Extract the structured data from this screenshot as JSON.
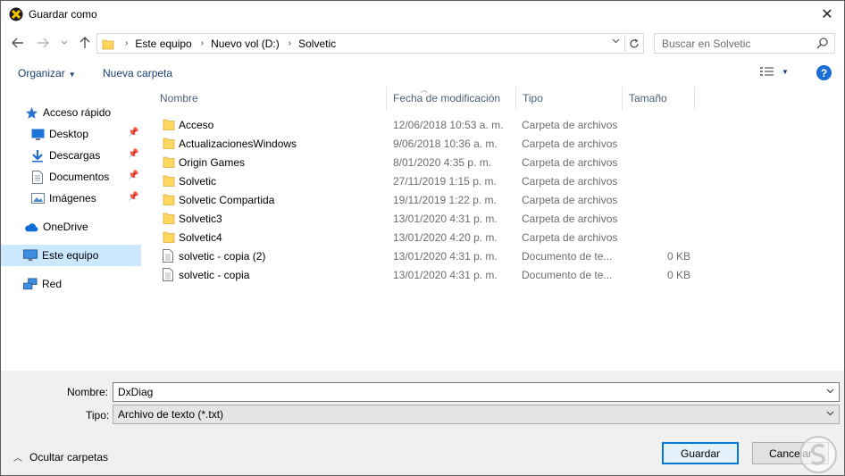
{
  "window": {
    "title": "Guardar como",
    "close_glyph": "✕"
  },
  "address": {
    "crumbs": [
      "Este equipo",
      "Nuevo vol (D:)",
      "Solvetic"
    ],
    "search_placeholder": "Buscar en Solvetic"
  },
  "toolbar": {
    "organize": "Organizar",
    "new_folder": "Nueva carpeta"
  },
  "navpane": {
    "items": [
      {
        "label": "Acceso rápido",
        "icon": "star-icon",
        "pinned": false
      },
      {
        "label": "Desktop",
        "icon": "desktop-folder-icon",
        "pinned": true
      },
      {
        "label": "Descargas",
        "icon": "download-icon",
        "pinned": true
      },
      {
        "label": "Documentos",
        "icon": "document-icon",
        "pinned": true
      },
      {
        "label": "Imágenes",
        "icon": "pictures-icon",
        "pinned": true
      },
      {
        "label": "OneDrive",
        "icon": "cloud-icon",
        "pinned": false
      },
      {
        "label": "Este equipo",
        "icon": "computer-icon",
        "pinned": false,
        "selected": true
      },
      {
        "label": "Red",
        "icon": "network-icon",
        "pinned": false
      }
    ]
  },
  "columns": {
    "name": "Nombre",
    "modified": "Fecha de modificación",
    "type": "Tipo",
    "size": "Tamaño"
  },
  "files": [
    {
      "name": "Acceso",
      "modified": "12/06/2018 10:53 a. m.",
      "type": "Carpeta de archivos",
      "size": "",
      "kind": "folder"
    },
    {
      "name": "ActualizacionesWindows",
      "modified": "9/06/2018 10:36 a. m.",
      "type": "Carpeta de archivos",
      "size": "",
      "kind": "folder"
    },
    {
      "name": "Origin Games",
      "modified": "8/01/2020 4:35 p. m.",
      "type": "Carpeta de archivos",
      "size": "",
      "kind": "folder"
    },
    {
      "name": "Solvetic",
      "modified": "27/11/2019 1:15 p. m.",
      "type": "Carpeta de archivos",
      "size": "",
      "kind": "folder"
    },
    {
      "name": "Solvetic Compartida",
      "modified": "19/11/2019 1:22 p. m.",
      "type": "Carpeta de archivos",
      "size": "",
      "kind": "folder"
    },
    {
      "name": "Solvetic3",
      "modified": "13/01/2020 4:31 p. m.",
      "type": "Carpeta de archivos",
      "size": "",
      "kind": "folder"
    },
    {
      "name": "Solvetic4",
      "modified": "13/01/2020 4:20 p. m.",
      "type": "Carpeta de archivos",
      "size": "",
      "kind": "folder"
    },
    {
      "name": "solvetic - copia (2)",
      "modified": "13/01/2020 4:31 p. m.",
      "type": "Documento de te...",
      "size": "0 KB",
      "kind": "file"
    },
    {
      "name": "solvetic - copia",
      "modified": "13/01/2020 4:31 p. m.",
      "type": "Documento de te...",
      "size": "0 KB",
      "kind": "file"
    }
  ],
  "form": {
    "name_label": "Nombre:",
    "name_value": "DxDiag",
    "type_label": "Tipo:",
    "type_value": "Archivo de texto (*.txt)",
    "hide_folders": "Ocultar carpetas",
    "save": "Guardar",
    "cancel": "Cancelar"
  },
  "colors": {
    "accent": "#0078d7",
    "selected_bg": "#cce8ff",
    "folder": "#ffd75e",
    "link": "#1a3f73"
  }
}
